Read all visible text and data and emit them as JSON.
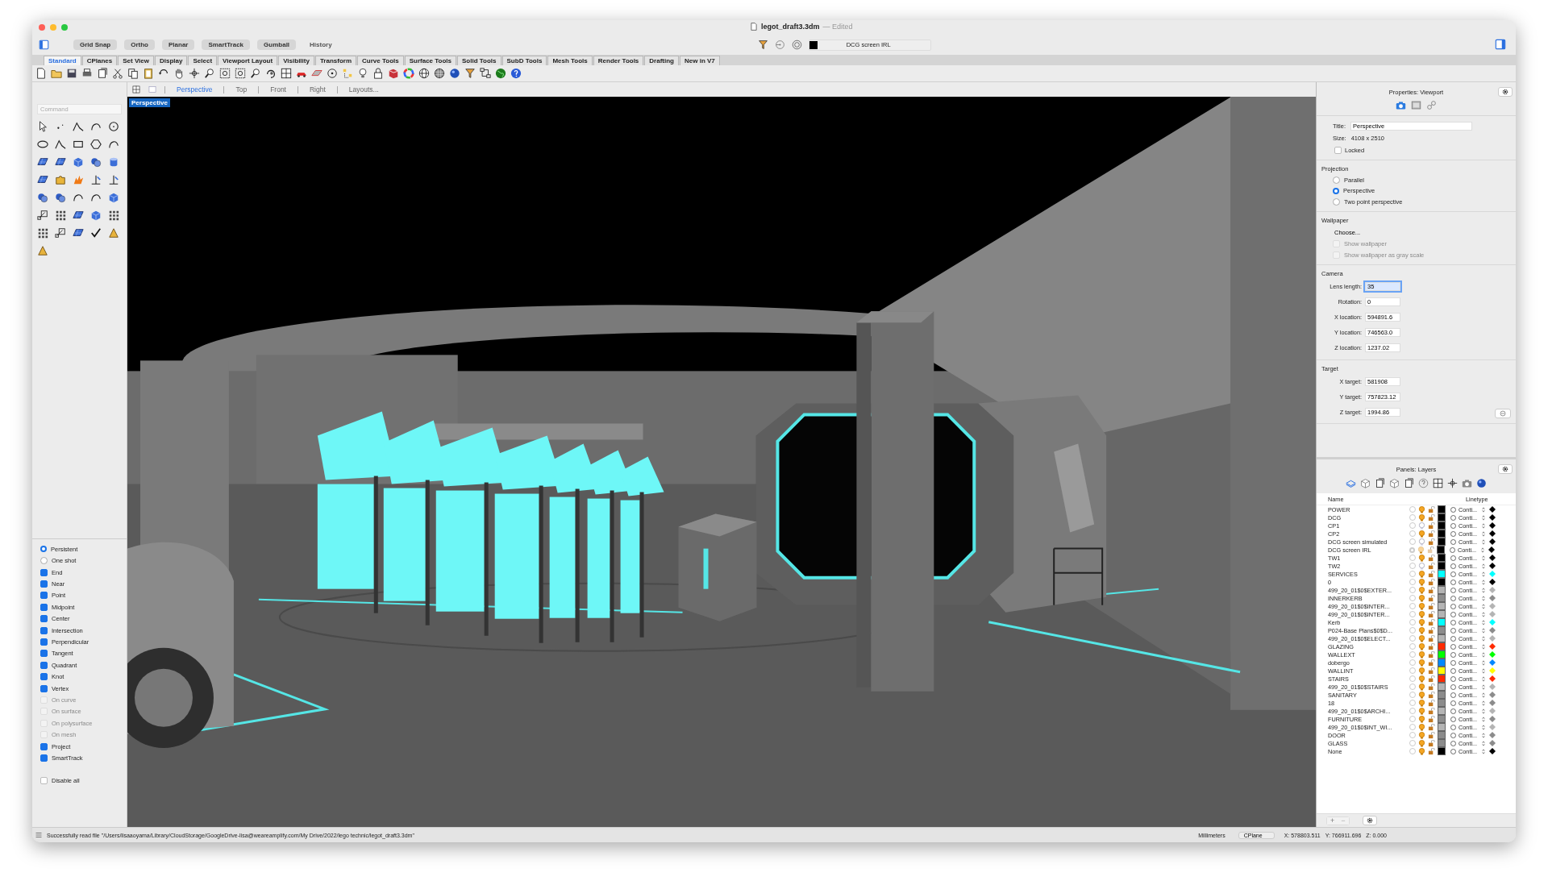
{
  "window": {
    "title": "legot_draft3.3dm",
    "edited": "— Edited"
  },
  "toggles": [
    {
      "label": "Grid Snap",
      "on": true
    },
    {
      "label": "Ortho",
      "on": true
    },
    {
      "label": "Planar",
      "on": true
    },
    {
      "label": "SmartTrack",
      "on": true
    },
    {
      "label": "Gumball",
      "on": true
    },
    {
      "label": "History",
      "on": false
    }
  ],
  "current_layer": {
    "name": "DCG screen IRL",
    "color": "#000000"
  },
  "toolbar_tabs": [
    {
      "label": "Standard",
      "selected": true
    },
    {
      "label": "CPlanes",
      "selected": false
    },
    {
      "label": "Set View",
      "selected": false
    },
    {
      "label": "Display",
      "selected": false
    },
    {
      "label": "Select",
      "selected": false
    },
    {
      "label": "Viewport Layout",
      "selected": false
    },
    {
      "label": "Visibility",
      "selected": false
    },
    {
      "label": "Transform",
      "selected": false
    },
    {
      "label": "Curve Tools",
      "selected": false
    },
    {
      "label": "Surface Tools",
      "selected": false
    },
    {
      "label": "Solid Tools",
      "selected": false
    },
    {
      "label": "SubD Tools",
      "selected": false
    },
    {
      "label": "Mesh Tools",
      "selected": false
    },
    {
      "label": "Render Tools",
      "selected": false
    },
    {
      "label": "Drafting",
      "selected": false
    },
    {
      "label": "New in V7",
      "selected": false
    }
  ],
  "command": {
    "placeholder": "Command"
  },
  "view_tabs": [
    {
      "label": "Perspective",
      "selected": true
    },
    {
      "label": "Top",
      "selected": false
    },
    {
      "label": "Front",
      "selected": false
    },
    {
      "label": "Right",
      "selected": false
    },
    {
      "label": "Layouts...",
      "selected": false
    }
  ],
  "viewport": {
    "label": "Perspective"
  },
  "osnap": {
    "modes": [
      {
        "label": "Persistent",
        "selected": true
      },
      {
        "label": "One shot",
        "selected": false
      }
    ],
    "snaps": [
      {
        "label": "End",
        "checked": true,
        "disabled": false
      },
      {
        "label": "Near",
        "checked": true,
        "disabled": false
      },
      {
        "label": "Point",
        "checked": true,
        "disabled": false
      },
      {
        "label": "Midpoint",
        "checked": true,
        "disabled": false
      },
      {
        "label": "Center",
        "checked": true,
        "disabled": false
      },
      {
        "label": "Intersection",
        "checked": true,
        "disabled": false
      },
      {
        "label": "Perpendicular",
        "checked": true,
        "disabled": false
      },
      {
        "label": "Tangent",
        "checked": true,
        "disabled": false
      },
      {
        "label": "Quadrant",
        "checked": true,
        "disabled": false
      },
      {
        "label": "Knot",
        "checked": true,
        "disabled": false
      },
      {
        "label": "Vertex",
        "checked": true,
        "disabled": false
      },
      {
        "label": "On curve",
        "checked": false,
        "disabled": true
      },
      {
        "label": "On surface",
        "checked": false,
        "disabled": true
      },
      {
        "label": "On polysurface",
        "checked": false,
        "disabled": true
      },
      {
        "label": "On mesh",
        "checked": false,
        "disabled": true
      },
      {
        "label": "Project",
        "checked": true,
        "disabled": false
      },
      {
        "label": "SmartTrack",
        "checked": true,
        "disabled": false
      }
    ],
    "disable_all": {
      "label": "Disable all",
      "checked": false
    }
  },
  "properties": {
    "header": "Properties: Viewport",
    "title_label": "Title:",
    "title_value": "Perspective",
    "size_label": "Size:",
    "size_value": "4108 x 2510",
    "locked": {
      "label": "Locked",
      "checked": false
    },
    "projection": {
      "heading": "Projection",
      "options": [
        {
          "label": "Parallel",
          "selected": false
        },
        {
          "label": "Perspective",
          "selected": true
        },
        {
          "label": "Two point perspective",
          "selected": false
        }
      ]
    },
    "wallpaper": {
      "heading": "Wallpaper",
      "choose": "Choose...",
      "options": [
        {
          "label": "Show wallpaper",
          "checked": false,
          "disabled": true
        },
        {
          "label": "Show wallpaper as gray scale",
          "checked": false,
          "disabled": true
        }
      ]
    },
    "camera": {
      "heading": "Camera",
      "fields": [
        {
          "label": "Lens length:",
          "value": "35",
          "focused": true
        },
        {
          "label": "Rotation:",
          "value": "0",
          "focused": false
        },
        {
          "label": "X location:",
          "value": "594891.6",
          "focused": false
        },
        {
          "label": "Y location:",
          "value": "746563.0",
          "focused": false
        },
        {
          "label": "Z location:",
          "value": "1237.02",
          "focused": false
        }
      ]
    },
    "target": {
      "heading": "Target",
      "fields": [
        {
          "label": "X target:",
          "value": "581908",
          "focused": false
        },
        {
          "label": "Y target:",
          "value": "757823.12",
          "focused": false
        },
        {
          "label": "Z target:",
          "value": "1994.86",
          "focused": false
        }
      ]
    }
  },
  "layers": {
    "header": "Panels: Layers",
    "columns": [
      "Name",
      "Linetype"
    ],
    "buttons": [
      "+",
      "−"
    ],
    "rows": [
      {
        "name": "POWER",
        "selected": false,
        "visible": true,
        "color": "#000000",
        "linetype": "Conti..."
      },
      {
        "name": "DCG",
        "selected": false,
        "visible": true,
        "color": "#000000",
        "linetype": "Conti..."
      },
      {
        "name": "CP1",
        "selected": false,
        "visible": false,
        "color": "#000000",
        "linetype": "Conti..."
      },
      {
        "name": "CP2",
        "selected": false,
        "visible": true,
        "color": "#000000",
        "linetype": "Conti..."
      },
      {
        "name": "DCG screen simulated",
        "selected": false,
        "visible": false,
        "color": "#000000",
        "linetype": "Conti..."
      },
      {
        "name": "DCG screen IRL",
        "selected": true,
        "visible": true,
        "color": "#000000",
        "linetype": "Conti..."
      },
      {
        "name": "TW1",
        "selected": false,
        "visible": true,
        "color": "#000000",
        "linetype": "Conti..."
      },
      {
        "name": "TW2",
        "selected": false,
        "visible": false,
        "color": "#000000",
        "linetype": "Conti..."
      },
      {
        "name": "SERVICES",
        "selected": false,
        "visible": true,
        "color": "#00ffff",
        "linetype": "Conti..."
      },
      {
        "name": "0",
        "selected": false,
        "visible": true,
        "color": "#000000",
        "linetype": "Conti..."
      },
      {
        "name": "499_20_01$0$EXTER...",
        "selected": false,
        "visible": true,
        "color": "#b4b4b4",
        "linetype": "Conti..."
      },
      {
        "name": "INNERKERB",
        "selected": false,
        "visible": true,
        "color": "#8c8c8c",
        "linetype": "Conti..."
      },
      {
        "name": "499_20_01$0$INTER...",
        "selected": false,
        "visible": true,
        "color": "#b4b4b4",
        "linetype": "Conti..."
      },
      {
        "name": "499_20_01$0$INTER...",
        "selected": false,
        "visible": true,
        "color": "#b4b4b4",
        "linetype": "Conti..."
      },
      {
        "name": "Kerb",
        "selected": false,
        "visible": true,
        "color": "#00ffff",
        "linetype": "Conti..."
      },
      {
        "name": "P024-Base Plans$0$D...",
        "selected": false,
        "visible": true,
        "color": "#8c8c8c",
        "linetype": "Conti..."
      },
      {
        "name": "499_20_01$0$ELECT...",
        "selected": false,
        "visible": true,
        "color": "#b4b4b4",
        "linetype": "Conti..."
      },
      {
        "name": "GLAZING",
        "selected": false,
        "visible": true,
        "color": "#ff2a00",
        "linetype": "Conti..."
      },
      {
        "name": "WALLEXT",
        "selected": false,
        "visible": true,
        "color": "#00ff00",
        "linetype": "Conti..."
      },
      {
        "name": "dobergo",
        "selected": false,
        "visible": true,
        "color": "#0088ff",
        "linetype": "Conti..."
      },
      {
        "name": "WALLINT",
        "selected": false,
        "visible": true,
        "color": "#ffff00",
        "linetype": "Conti..."
      },
      {
        "name": "STAIRS",
        "selected": false,
        "visible": true,
        "color": "#ff2a00",
        "linetype": "Conti..."
      },
      {
        "name": "499_20_01$0$STAIRS",
        "selected": false,
        "visible": true,
        "color": "#b4b4b4",
        "linetype": "Conti..."
      },
      {
        "name": "SANITARY",
        "selected": false,
        "visible": true,
        "color": "#8c8c8c",
        "linetype": "Conti..."
      },
      {
        "name": "18",
        "selected": false,
        "visible": true,
        "color": "#8c8c8c",
        "linetype": "Conti..."
      },
      {
        "name": "499_20_01$0$ARCHI...",
        "selected": false,
        "visible": true,
        "color": "#b4b4b4",
        "linetype": "Conti..."
      },
      {
        "name": "FURNITURE",
        "selected": false,
        "visible": true,
        "color": "#8c8c8c",
        "linetype": "Conti..."
      },
      {
        "name": "499_20_01$0$INT_WI...",
        "selected": false,
        "visible": true,
        "color": "#b4b4b4",
        "linetype": "Conti..."
      },
      {
        "name": "DOOR",
        "selected": false,
        "visible": true,
        "color": "#8c8c8c",
        "linetype": "Conti..."
      },
      {
        "name": "GLASS",
        "selected": false,
        "visible": true,
        "color": "#8c8c8c",
        "linetype": "Conti..."
      },
      {
        "name": "None",
        "selected": false,
        "visible": true,
        "color": "#000000",
        "linetype": "Conti..."
      }
    ]
  },
  "status_bar": {
    "message": "Successfully read file \"/Users/lisaaoyama/Library/CloudStorage/GoogleDrive-lisa@weareamplify.com/My Drive/2022/lego technic/legot_draft3.3dm\"",
    "units": "Millimeters",
    "cplane": "CPlane",
    "x": "X: 578803.511",
    "y": "Y: 766911.696",
    "z": "Z: 0.000"
  }
}
